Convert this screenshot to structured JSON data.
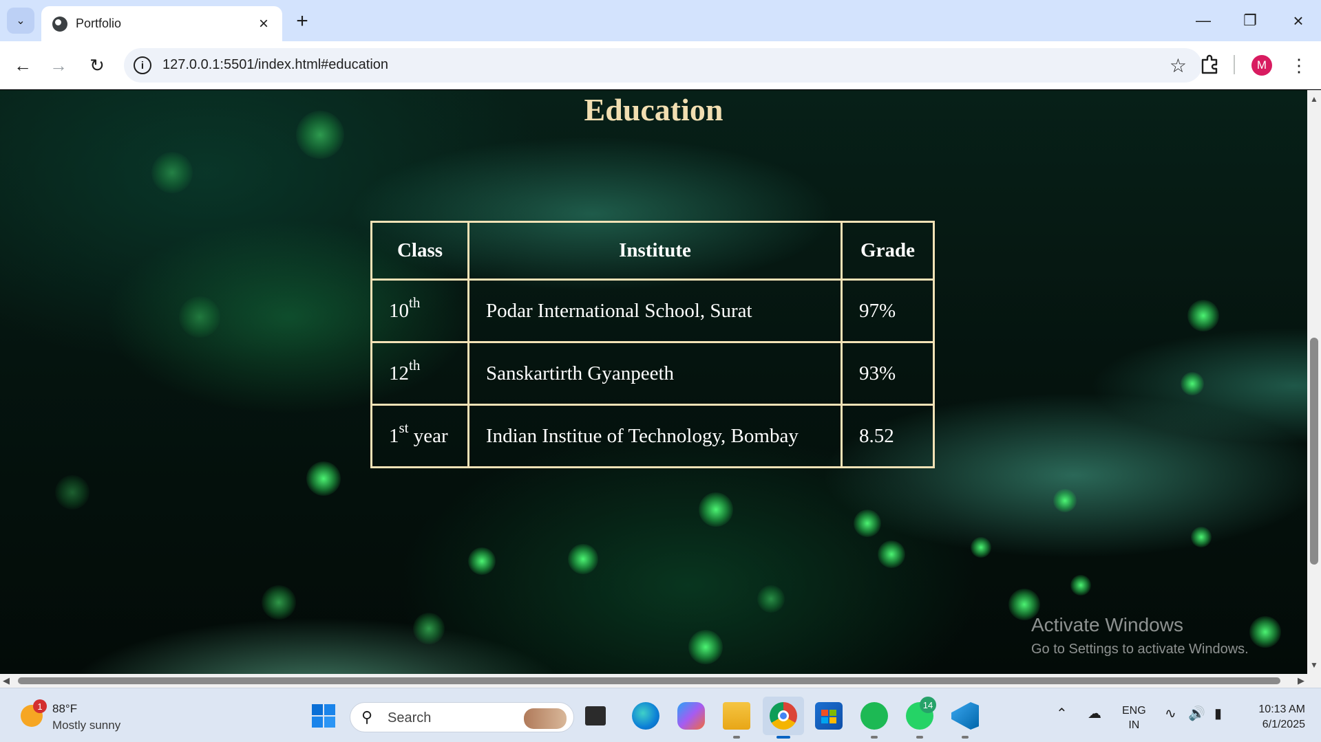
{
  "browser": {
    "tab_title": "Portfolio",
    "url": "127.0.0.1:5501/index.html#education",
    "profile_initial": "M"
  },
  "page": {
    "heading": "Education",
    "table": {
      "headers": [
        "Class",
        "Institute",
        "Grade"
      ],
      "rows": [
        {
          "class_num": "10",
          "class_sup": "th",
          "class_suffix": "",
          "institute": "Podar International School, Surat",
          "grade": "97%"
        },
        {
          "class_num": "12",
          "class_sup": "th",
          "class_suffix": "",
          "institute": "Sanskartirth Gyanpeeth",
          "grade": "93%"
        },
        {
          "class_num": "1",
          "class_sup": "st",
          "class_suffix": " year",
          "institute": "Indian Institue of Technology, Bombay",
          "grade": "8.52"
        }
      ]
    },
    "watermark": {
      "line1": "Activate Windows",
      "line2": "Go to Settings to activate Windows."
    }
  },
  "taskbar": {
    "weather_temp": "88°F",
    "weather_condition": "Mostly sunny",
    "weather_badge": "1",
    "search_label": "Search",
    "whatsapp_badge": "14",
    "lang_line1": "ENG",
    "lang_line2": "IN",
    "time": "10:13 AM",
    "date": "6/1/2025"
  },
  "colors": {
    "heading": "#f1deb1",
    "table_border": "#f3e2b6",
    "tab_strip": "#d3e3fd"
  }
}
